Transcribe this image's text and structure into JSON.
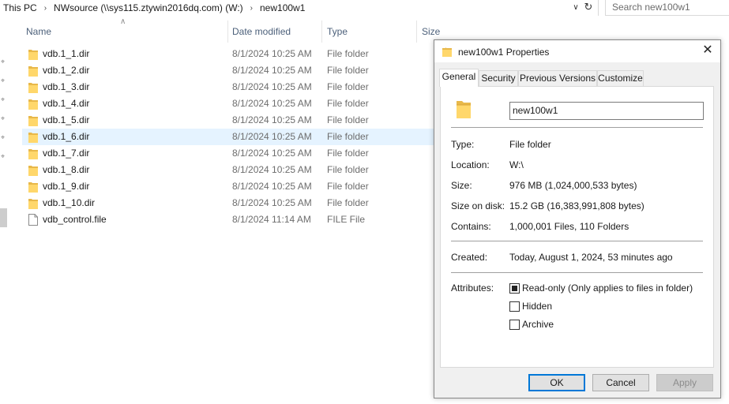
{
  "address": {
    "crumbs": [
      "This PC",
      "NWsource (\\\\sys115.ztywin2016dq.com) (W:)",
      "new100w1"
    ],
    "search_placeholder": "Search new100w1"
  },
  "columns": {
    "name": "Name",
    "date": "Date modified",
    "type": "Type",
    "size": "Size"
  },
  "files": [
    {
      "name": "vdb.1_1.dir",
      "date": "8/1/2024 10:25 AM",
      "type": "File folder",
      "icon": "folder-icon"
    },
    {
      "name": "vdb.1_2.dir",
      "date": "8/1/2024 10:25 AM",
      "type": "File folder",
      "icon": "folder-icon"
    },
    {
      "name": "vdb.1_3.dir",
      "date": "8/1/2024 10:25 AM",
      "type": "File folder",
      "icon": "folder-icon"
    },
    {
      "name": "vdb.1_4.dir",
      "date": "8/1/2024 10:25 AM",
      "type": "File folder",
      "icon": "folder-icon"
    },
    {
      "name": "vdb.1_5.dir",
      "date": "8/1/2024 10:25 AM",
      "type": "File folder",
      "icon": "folder-icon"
    },
    {
      "name": "vdb.1_6.dir",
      "date": "8/1/2024 10:25 AM",
      "type": "File folder",
      "icon": "folder-icon",
      "selected": true
    },
    {
      "name": "vdb.1_7.dir",
      "date": "8/1/2024 10:25 AM",
      "type": "File folder",
      "icon": "folder-icon"
    },
    {
      "name": "vdb.1_8.dir",
      "date": "8/1/2024 10:25 AM",
      "type": "File folder",
      "icon": "folder-icon"
    },
    {
      "name": "vdb.1_9.dir",
      "date": "8/1/2024 10:25 AM",
      "type": "File folder",
      "icon": "folder-icon"
    },
    {
      "name": "vdb.1_10.dir",
      "date": "8/1/2024 10:25 AM",
      "type": "File folder",
      "icon": "folder-icon"
    },
    {
      "name": "vdb_control.file",
      "date": "8/1/2024 11:14 AM",
      "type": "FILE File",
      "icon": "file-icon"
    }
  ],
  "dialog": {
    "title": "new100w1 Properties",
    "tabs": [
      "General",
      "Security",
      "Previous Versions",
      "Customize"
    ],
    "active_tab": "General",
    "name_value": "new100w1",
    "props": {
      "type_label": "Type:",
      "type_value": "File folder",
      "location_label": "Location:",
      "location_value": "W:\\",
      "size_label": "Size:",
      "size_value": "976 MB (1,024,000,533 bytes)",
      "size_on_disk_label": "Size on disk:",
      "size_on_disk_value": "15.2 GB (16,383,991,808 bytes)",
      "contains_label": "Contains:",
      "contains_value": "1,000,001 Files, 110 Folders",
      "created_label": "Created:",
      "created_value": "Today, August 1, 2024, 53 minutes ago",
      "attributes_label": "Attributes:"
    },
    "attributes": {
      "readonly_label": "Read-only (Only applies to files in folder)",
      "readonly_state": "indeterminate",
      "hidden_label": "Hidden",
      "hidden_state": "unchecked",
      "archive_label": "Archive",
      "archive_state": "unchecked"
    },
    "buttons": {
      "ok": "OK",
      "cancel": "Cancel",
      "apply": "Apply"
    }
  },
  "colors": {
    "selection": "#e5f3ff",
    "folder_yellow": "#ffd76b",
    "header_text": "#4c607a",
    "default_button_border": "#0078d7"
  }
}
